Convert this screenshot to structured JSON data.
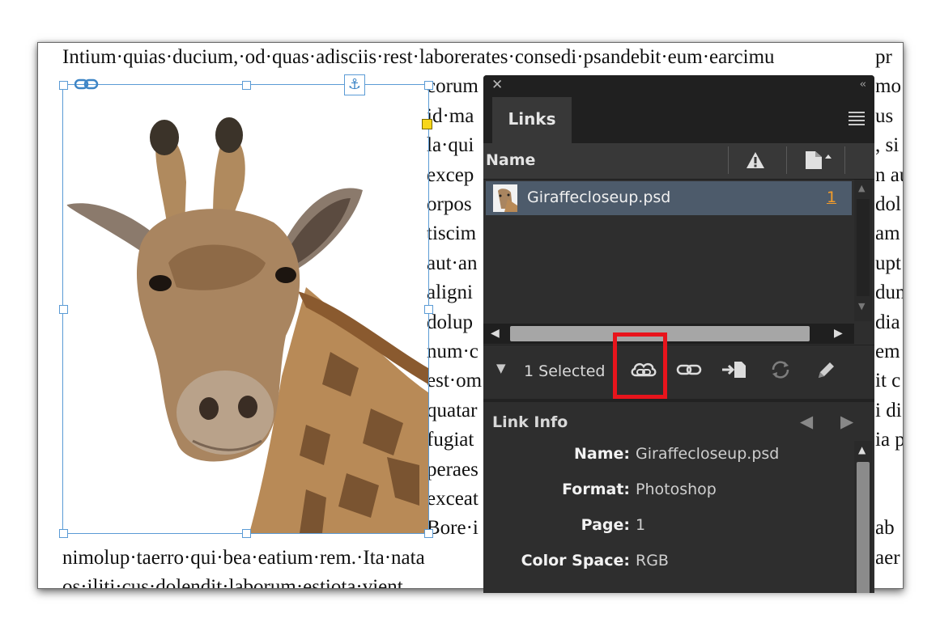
{
  "document": {
    "lines": [
      "Intium·quias·ducium,·od·quas·adisciis·rest·laborerates·consedi·psandebit·eum·earcimu",
      "corum",
      "id·ma",
      "la·qui",
      "excep",
      "orpos",
      "tiscim",
      "aut·an",
      "aligni",
      "dolup",
      "num·c",
      "est·om",
      "quatar",
      "fugiat",
      "peraes",
      "exceat",
      "Bore·i",
      "nimolup·taerro·qui·bea·eatium·rem.·Ita·nata",
      "os·iliti·cus·dolendit·laborum·estiota·vient"
    ],
    "right_edge": [
      "pr",
      "mo",
      "us",
      ", si",
      "n au",
      "dol",
      "am",
      "upt",
      "dun",
      "dia",
      "em",
      "it c",
      "i di",
      "ia p",
      "",
      "",
      "ab",
      "aer",
      ""
    ]
  },
  "panel": {
    "close_glyph": "✕",
    "collapse_glyph": "‹‹",
    "tab": "Links",
    "column_name": "Name",
    "link": {
      "name": "Giraffecloseup.psd",
      "page": "1"
    },
    "selected_text": "1 Selected",
    "toolbar_icons": [
      "cloud-link-icon",
      "relink-icon",
      "go-to-link-icon",
      "update-link-icon",
      "edit-original-icon"
    ],
    "info_title": "Link Info",
    "info": [
      {
        "key": "Name:",
        "value": "Giraffecloseup.psd"
      },
      {
        "key": "Format:",
        "value": "Photoshop"
      },
      {
        "key": "Page:",
        "value": "1"
      },
      {
        "key": "Color Space:",
        "value": "RGB"
      }
    ]
  },
  "colors": {
    "panel_bg": "#2e2e2e",
    "selected_row": "#4d5b6b",
    "highlight": "#e8141c",
    "frame": "#5b9bd5",
    "page_link": "#f39c2a"
  }
}
